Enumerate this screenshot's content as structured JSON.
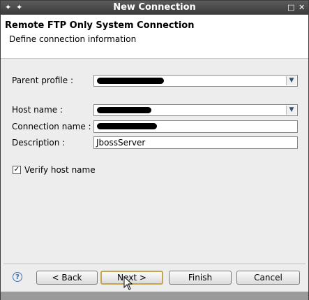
{
  "window": {
    "title": "New Connection"
  },
  "header": {
    "title": "Remote FTP Only System Connection",
    "subtitle": "Define connection information"
  },
  "form": {
    "parent_profile": {
      "label": "Parent profile :",
      "value": ""
    },
    "host_name": {
      "label": "Host name :",
      "value": ""
    },
    "connection_name": {
      "label": "Connection name :",
      "value": ""
    },
    "description": {
      "label": "Description :",
      "value": "JbossServer"
    },
    "verify_host": {
      "label": "Verify host name",
      "checked": true
    }
  },
  "buttons": {
    "back": "< Back",
    "next": "Next >",
    "finish": "Finish",
    "cancel": "Cancel"
  },
  "icons": {
    "help": "help-icon",
    "menu": "window-menu-icon",
    "pin": "pin-icon",
    "maximize": "maximize-icon",
    "close": "close-icon"
  }
}
